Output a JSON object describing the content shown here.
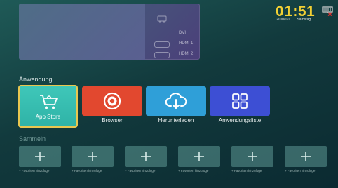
{
  "clock": {
    "time": "01:51",
    "date": "2000/1/1",
    "day": "Samstag"
  },
  "preview": {
    "ports": [
      "DVI",
      "HDMI 1",
      "HDMI 2"
    ]
  },
  "sections": {
    "apps_title": "Anwendung",
    "favorites_title": "Sammeln"
  },
  "apps": [
    {
      "label": "App Store",
      "color": "#33bcae",
      "icon": "cart-icon"
    },
    {
      "label": "Browser",
      "color": "#e2482f",
      "icon": "browser-icon"
    },
    {
      "label": "Herunterladen",
      "color": "#2f9fd8",
      "icon": "cloud-download-icon"
    },
    {
      "label": "Anwendungsliste",
      "color": "#3d4fd4",
      "icon": "grid-icon"
    }
  ],
  "favorites": {
    "label": "+ Favoriten hinzufüge",
    "count": 6
  },
  "colors": {
    "accent": "#f2d034",
    "selected_border": "#e9c750"
  }
}
